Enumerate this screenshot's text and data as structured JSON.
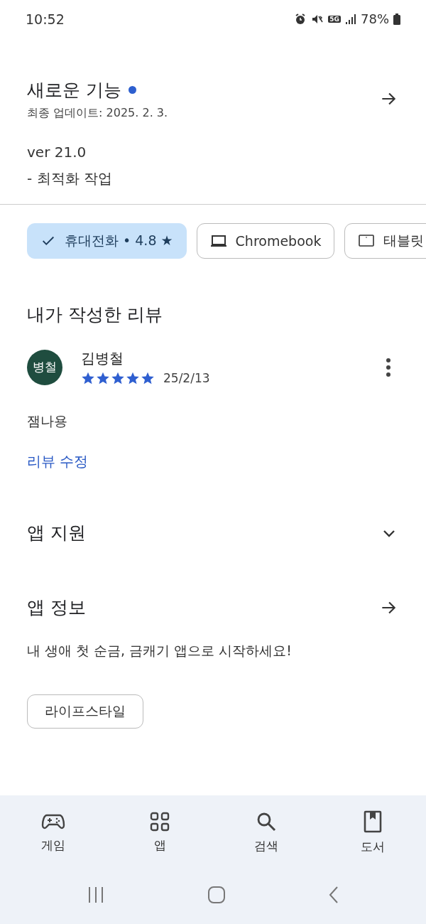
{
  "status_bar": {
    "time": "10:52",
    "network": "5G",
    "battery": "78%"
  },
  "whats_new": {
    "title": "새로운 기능",
    "updated": "최종 업데이트: 2025. 2. 3.",
    "version": "ver 21.0",
    "notes": "- 최적화 작업"
  },
  "device_chips": [
    {
      "label": "휴대전화 • 4.8 ★",
      "kind": "check",
      "selected": true
    },
    {
      "label": "Chromebook",
      "kind": "laptop",
      "selected": false
    },
    {
      "label": "태블릿",
      "kind": "tablet",
      "selected": false
    }
  ],
  "my_review": {
    "heading": "내가 작성한 리뷰",
    "avatar": "병철",
    "author": "김병철",
    "stars": 5,
    "date": "25/2/13",
    "text": "잼나용",
    "edit_link": "리뷰 수정"
  },
  "app_support": {
    "title": "앱 지원",
    "expanded": false
  },
  "app_info": {
    "title": "앱 정보",
    "description": "내 생애 첫 순금, 금캐기 앱으로 시작하세요!",
    "category": "라이프스타일"
  },
  "bottom_nav": [
    {
      "label": "게임",
      "kind": "games",
      "selected": false
    },
    {
      "label": "앱",
      "kind": "apps",
      "selected": false
    },
    {
      "label": "검색",
      "kind": "search",
      "selected": false
    },
    {
      "label": "도서",
      "kind": "books",
      "selected": false
    }
  ]
}
